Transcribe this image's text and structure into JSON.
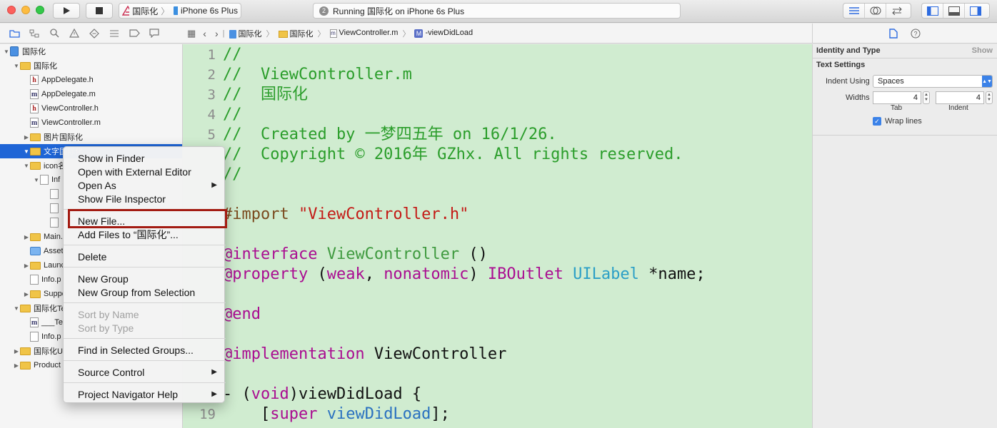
{
  "toolbar": {
    "scheme_project": "国际化",
    "scheme_device": "iPhone 6s Plus",
    "activity_count": "2",
    "activity_text": "Running 国际化 on iPhone 6s Plus",
    "colors": {
      "close": "#fc605c",
      "minimize": "#fdbc40",
      "zoom": "#34c84a"
    }
  },
  "navigator_icons": [
    "folder-icon",
    "hierarchy-icon",
    "search-icon",
    "warning-icon",
    "test-diamond-icon",
    "list-icon",
    "breakpoint-icon",
    "message-icon"
  ],
  "tree": [
    {
      "label": "国际化",
      "kind": "project",
      "depth": 0,
      "open": true
    },
    {
      "label": "国际化",
      "kind": "folder",
      "depth": 1,
      "open": true
    },
    {
      "label": "AppDelegate.h",
      "kind": "h",
      "depth": 2
    },
    {
      "label": "AppDelegate.m",
      "kind": "m",
      "depth": 2
    },
    {
      "label": "ViewController.h",
      "kind": "h",
      "depth": 2
    },
    {
      "label": "ViewController.m",
      "kind": "m",
      "depth": 2
    },
    {
      "label": "图片国际化",
      "kind": "folder",
      "depth": 2,
      "closed": true
    },
    {
      "label": "文字国际化",
      "kind": "folder",
      "depth": 2,
      "open": true,
      "selected": true
    },
    {
      "label": "icon名",
      "kind": "folder",
      "depth": 2,
      "open": true
    },
    {
      "label": "Inf",
      "kind": "file",
      "depth": 3,
      "open": true
    },
    {
      "label": "",
      "kind": "file",
      "depth": 4
    },
    {
      "label": "",
      "kind": "file",
      "depth": 4
    },
    {
      "label": "",
      "kind": "file",
      "depth": 4
    },
    {
      "label": "Main.",
      "kind": "folder",
      "depth": 2,
      "closed": true
    },
    {
      "label": "Asset",
      "kind": "assets",
      "depth": 2
    },
    {
      "label": "Launc",
      "kind": "folder",
      "depth": 2,
      "closed": true
    },
    {
      "label": "Info.p",
      "kind": "file",
      "depth": 2
    },
    {
      "label": "Suppo",
      "kind": "folder",
      "depth": 2,
      "closed": true
    },
    {
      "label": "国际化Te",
      "kind": "folder",
      "depth": 1,
      "open": true
    },
    {
      "label": "___Te",
      "kind": "m",
      "depth": 2
    },
    {
      "label": "Info.p",
      "kind": "file",
      "depth": 2
    },
    {
      "label": "国际化U",
      "kind": "folder",
      "depth": 1,
      "closed": true
    },
    {
      "label": "Product",
      "kind": "folder",
      "depth": 1,
      "closed": true
    }
  ],
  "jumpbar": {
    "crumbs": [
      "国际化",
      "国际化",
      "ViewController.m",
      "-viewDidLoad"
    ]
  },
  "editor": {
    "line_numbers": [
      "1",
      "2",
      "3",
      "4",
      "5",
      "",
      "",
      "",
      "",
      "",
      "",
      "",
      "",
      "",
      "",
      "",
      "",
      "",
      "19"
    ],
    "lines": [
      [
        {
          "t": "//",
          "c": "com"
        }
      ],
      [
        {
          "t": "//  ViewController.m",
          "c": "com"
        }
      ],
      [
        {
          "t": "//  国际化",
          "c": "com"
        }
      ],
      [
        {
          "t": "//",
          "c": "com"
        }
      ],
      [
        {
          "t": "//  Created by 一梦四五年 on 16/1/26.",
          "c": "com"
        }
      ],
      [
        {
          "t": "//  Copyright © 2016年 GZhx. All rights reserved.",
          "c": "com"
        }
      ],
      [
        {
          "t": "//",
          "c": "com"
        }
      ],
      [
        {
          "t": "",
          "c": ""
        }
      ],
      [
        {
          "t": "#import ",
          "c": "pre"
        },
        {
          "t": "\"ViewController.h\"",
          "c": "str"
        }
      ],
      [
        {
          "t": "",
          "c": ""
        }
      ],
      [
        {
          "t": "@interface ",
          "c": "kw"
        },
        {
          "t": "ViewController",
          "c": "cls"
        },
        {
          "t": " ()",
          "c": ""
        }
      ],
      [
        {
          "t": "@property ",
          "c": "kw"
        },
        {
          "t": "(",
          "c": ""
        },
        {
          "t": "weak",
          "c": "kw"
        },
        {
          "t": ", ",
          "c": ""
        },
        {
          "t": "nonatomic",
          "c": "kw"
        },
        {
          "t": ") ",
          "c": ""
        },
        {
          "t": "IBOutlet ",
          "c": "ib"
        },
        {
          "t": "UILabel",
          "c": "ui"
        },
        {
          "t": " *name;",
          "c": ""
        }
      ],
      [
        {
          "t": "",
          "c": ""
        }
      ],
      [
        {
          "t": "@end",
          "c": "kw"
        }
      ],
      [
        {
          "t": "",
          "c": ""
        }
      ],
      [
        {
          "t": "@implementation ",
          "c": "kw"
        },
        {
          "t": "ViewController",
          "c": ""
        }
      ],
      [
        {
          "t": "",
          "c": ""
        }
      ],
      [
        {
          "t": "- (",
          "c": ""
        },
        {
          "t": "void",
          "c": "kw"
        },
        {
          "t": ")viewDidLoad {",
          "c": ""
        }
      ],
      [
        {
          "t": "    [",
          "c": ""
        },
        {
          "t": "super",
          "c": "kw"
        },
        {
          "t": " ",
          "c": ""
        },
        {
          "t": "viewDidLoad",
          "c": "meth"
        },
        {
          "t": "];",
          "c": ""
        }
      ]
    ]
  },
  "inspector": {
    "section_identity": "Identity and Type",
    "show_label": "Show",
    "section_text": "Text Settings",
    "indent_using_label": "Indent Using",
    "indent_using_value": "Spaces",
    "widths_label": "Widths",
    "tab_value": "4",
    "indent_value": "4",
    "tab_caption": "Tab",
    "indent_caption": "Indent",
    "wrap_lines_label": "Wrap lines"
  },
  "context_menu": {
    "items": [
      {
        "label": "Show in Finder"
      },
      {
        "label": "Open with External Editor"
      },
      {
        "label": "Open As",
        "submenu": true
      },
      {
        "label": "Show File Inspector"
      },
      {
        "sep": true
      },
      {
        "label": "New File..."
      },
      {
        "label": "Add Files to “国际化”..."
      },
      {
        "sep": true
      },
      {
        "label": "Delete"
      },
      {
        "sep": true
      },
      {
        "label": "New Group"
      },
      {
        "label": "New Group from Selection"
      },
      {
        "sep": true
      },
      {
        "label": "Sort by Name",
        "disabled": true
      },
      {
        "label": "Sort by Type",
        "disabled": true
      },
      {
        "sep": true
      },
      {
        "label": "Find in Selected Groups..."
      },
      {
        "sep": true
      },
      {
        "label": "Source Control",
        "submenu": true
      },
      {
        "sep": true
      },
      {
        "label": "Project Navigator Help",
        "submenu": true
      }
    ],
    "highlight_color": "#a31b12"
  }
}
